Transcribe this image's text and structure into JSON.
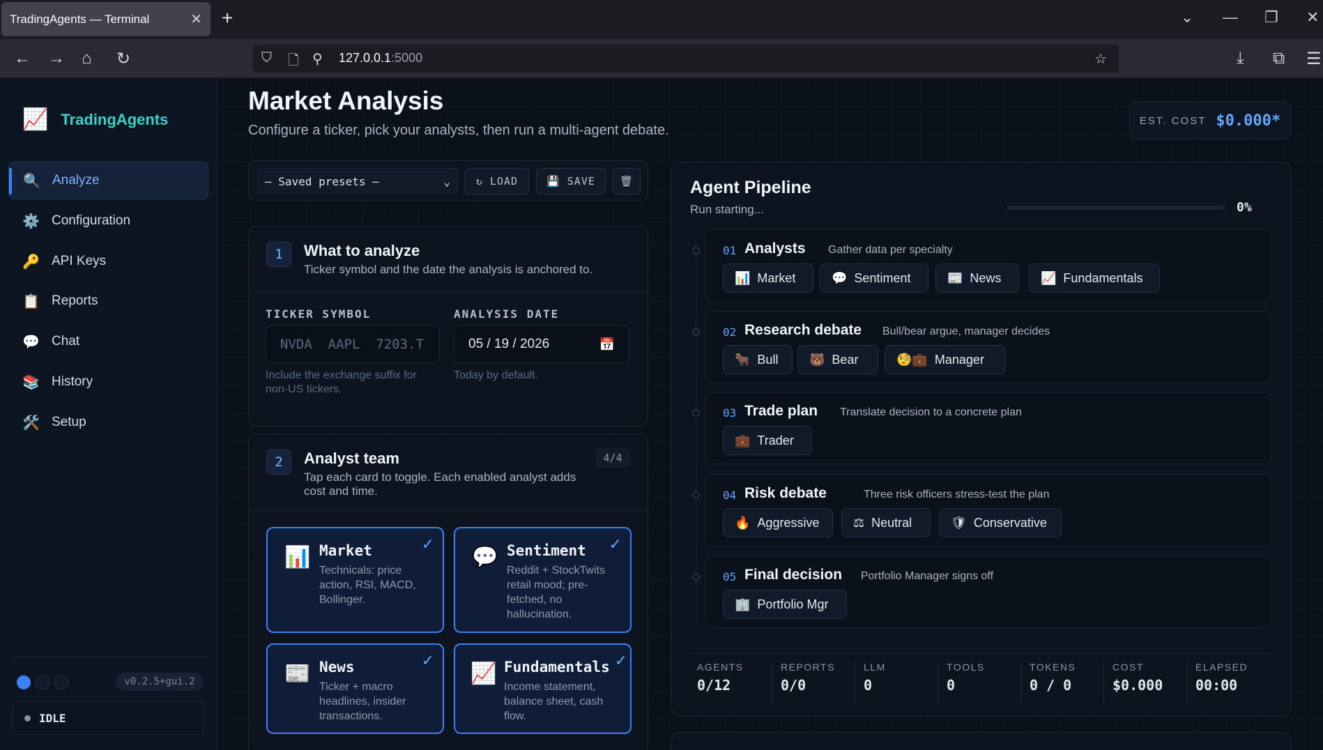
{
  "browser": {
    "tab_title": "TradingAgents — Terminal",
    "url_host": "127.0.0.1",
    "url_port": ":5000"
  },
  "sidebar": {
    "brand": "TradingAgents",
    "items": [
      {
        "label": "Analyze",
        "icon": "magnifier-icon"
      },
      {
        "label": "Configuration",
        "icon": "gear-icon"
      },
      {
        "label": "API Keys",
        "icon": "key-icon"
      },
      {
        "label": "Reports",
        "icon": "clipboard-icon"
      },
      {
        "label": "Chat",
        "icon": "speech-bubble-icon"
      },
      {
        "label": "History",
        "icon": "books-icon"
      },
      {
        "label": "Setup",
        "icon": "tools-icon"
      }
    ],
    "version": "v0.2.5+gui.2",
    "status": "IDLE"
  },
  "header": {
    "title": "Market Analysis",
    "subtitle": "Configure a ticker, pick your analysts, then run a multi-agent debate.",
    "cost_label": "EST. COST",
    "cost_value": "$0.000*"
  },
  "presets": {
    "selected": "— Saved presets —",
    "load_label": "LOAD",
    "save_label": "SAVE"
  },
  "step1": {
    "number": "1",
    "title": "What to analyze",
    "subtitle": "Ticker symbol and the date the analysis is anchored to.",
    "ticker_label": "TICKER SYMBOL",
    "ticker_placeholder": "NVDA  AAPL  7203.T",
    "ticker_help": "Include the exchange suffix for non-US tickers.",
    "date_label": "ANALYSIS DATE",
    "date_value": "05 / 19 / 2026",
    "date_help": "Today by default."
  },
  "step2": {
    "number": "2",
    "title": "Analyst team",
    "subtitle": "Tap each card to toggle. Each enabled analyst adds cost and time.",
    "count": "4/4",
    "analysts": [
      {
        "name": "Market",
        "desc": "Technicals: price action, RSI, MACD, Bollinger.",
        "icon": "bar-chart-icon"
      },
      {
        "name": "Sentiment",
        "desc": "Reddit + StockTwits retail mood; pre-fetched, no hallucination.",
        "icon": "speech-bubble-icon"
      },
      {
        "name": "News",
        "desc": "Ticker + macro headlines, insider transactions.",
        "icon": "newspaper-icon"
      },
      {
        "name": "Fundamentals",
        "desc": "Income statement, balance sheet, cash flow.",
        "icon": "chart-increasing-icon"
      }
    ]
  },
  "pipeline": {
    "title": "Agent Pipeline",
    "status": "Run starting...",
    "progress_pct": "0%",
    "progress_value": 0,
    "stages": [
      {
        "num": "01",
        "title": "Analysts",
        "desc": "Gather data per specialty",
        "chips": [
          {
            "glyph": "📊",
            "label": "Market"
          },
          {
            "glyph": "💬",
            "label": "Sentiment"
          },
          {
            "glyph": "📰",
            "label": "News"
          },
          {
            "glyph": "📈",
            "label": "Fundamentals"
          }
        ]
      },
      {
        "num": "02",
        "title": "Research debate",
        "desc": "Bull/bear argue, manager decides",
        "chips": [
          {
            "glyph": "🐂",
            "label": "Bull"
          },
          {
            "glyph": "🐻",
            "label": "Bear"
          },
          {
            "glyph": "🧐💼",
            "label": "Manager"
          }
        ]
      },
      {
        "num": "03",
        "title": "Trade plan",
        "desc": "Translate decision to a concrete plan",
        "chips": [
          {
            "glyph": "💼",
            "label": "Trader"
          }
        ]
      },
      {
        "num": "04",
        "title": "Risk debate",
        "desc": "Three risk officers stress-test the plan",
        "chips": [
          {
            "glyph": "🔥",
            "label": "Aggressive"
          },
          {
            "glyph": "⚖",
            "label": "Neutral"
          },
          {
            "glyph": "🛡",
            "label": "Conservative"
          }
        ]
      },
      {
        "num": "05",
        "title": "Final decision",
        "desc": "Portfolio Manager signs off",
        "chips": [
          {
            "glyph": "🏢",
            "label": "Portfolio Mgr"
          }
        ]
      }
    ],
    "stats": [
      {
        "label": "AGENTS",
        "value": "0/12"
      },
      {
        "label": "REPORTS",
        "value": "0/0"
      },
      {
        "label": "LLM",
        "value": "0"
      },
      {
        "label": "TOOLS",
        "value": "0"
      },
      {
        "label": "TOKENS",
        "value": "0 / 0"
      },
      {
        "label": "COST",
        "value": "$0.000"
      },
      {
        "label": "ELAPSED",
        "value": "00:00"
      }
    ]
  }
}
